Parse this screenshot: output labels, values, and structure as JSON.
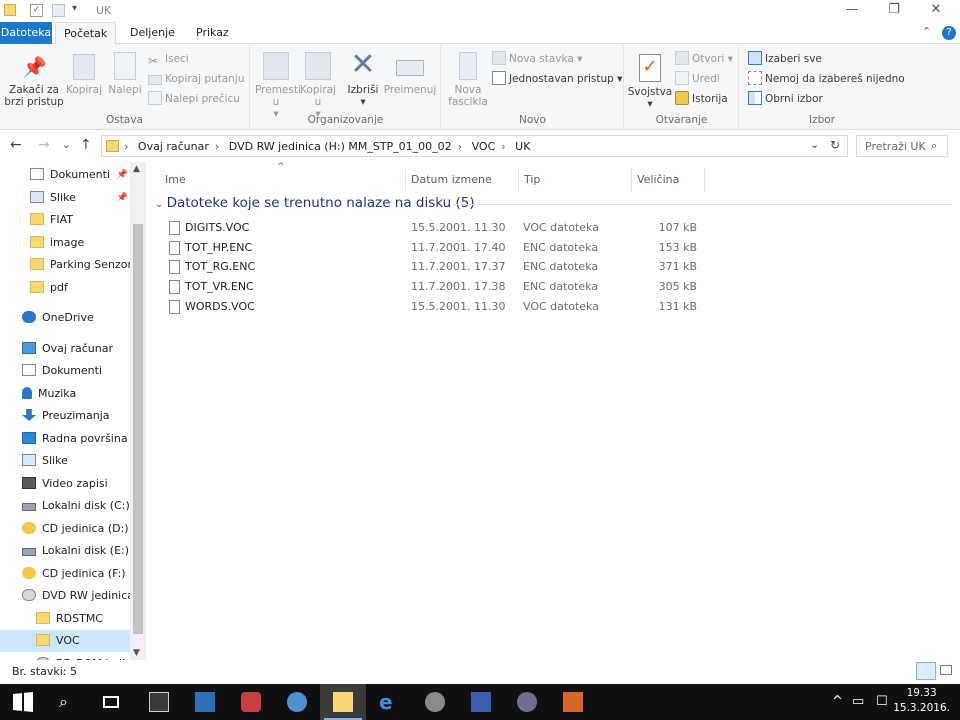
{
  "window": {
    "title": "UK",
    "controls": {
      "minimize": "—",
      "maximize": "❐",
      "close": "✕"
    }
  },
  "tabs": {
    "file": "Datoteka",
    "home": "Početak",
    "share": "Deljenje",
    "view": "Prikaz"
  },
  "ribbon": {
    "clipboard": {
      "label": "Ostava",
      "pin": "Zakači za brzi pristup",
      "copy": "Kopiraj",
      "paste": "Nalepi",
      "cut": "Iseci",
      "copy_path": "Kopiraj putanju",
      "paste_shortcut": "Nalepi prečicu"
    },
    "organize": {
      "label": "Organizovanje",
      "move_to": "Premesti u",
      "copy_to": "Kopiraj u",
      "delete": "Izbriši",
      "rename": "Preimenuj"
    },
    "new": {
      "label": "Novo",
      "new_folder": "Nova fascikla",
      "new_item": "Nova stavka",
      "easy_access": "Jednostavan pristup"
    },
    "open": {
      "label": "Otvaranje",
      "properties": "Svojstva",
      "open": "Otvori",
      "edit": "Uredi",
      "history": "Istorija"
    },
    "select": {
      "label": "Izbor",
      "select_all": "Izaberi sve",
      "select_none": "Nemoj da izabereš nijedno",
      "invert": "Obrni izbor"
    }
  },
  "address": {
    "crumbs": [
      "Ovaj računar",
      "DVD RW jedinica (H:) MM_STP_01_00_02",
      "VOC",
      "UK"
    ],
    "search_placeholder": "Pretraži UK"
  },
  "nav_pane": {
    "items": [
      {
        "label": "Dokumenti",
        "icon": "documents-icon",
        "pinned": true
      },
      {
        "label": "Slike",
        "icon": "pictures-icon",
        "pinned": true
      },
      {
        "label": "FIAT",
        "icon": "folder-icon"
      },
      {
        "label": "image",
        "icon": "folder-icon"
      },
      {
        "label": "Parking Senzori",
        "icon": "folder-icon"
      },
      {
        "label": "pdf",
        "icon": "folder-icon"
      },
      {
        "label": "OneDrive",
        "icon": "onedrive-icon"
      },
      {
        "label": "Ovaj računar",
        "icon": "computer-icon"
      },
      {
        "label": "Dokumenti",
        "icon": "documents-icon"
      },
      {
        "label": "Muzika",
        "icon": "music-icon"
      },
      {
        "label": "Preuzimanja",
        "icon": "downloads-icon"
      },
      {
        "label": "Radna površina",
        "icon": "desktop-icon"
      },
      {
        "label": "Slike",
        "icon": "pictures-icon"
      },
      {
        "label": "Video zapisi",
        "icon": "videos-icon"
      },
      {
        "label": "Lokalni disk (C:)",
        "icon": "drive-icon"
      },
      {
        "label": "CD jedinica (D:)",
        "icon": "cd-icon"
      },
      {
        "label": "Lokalni disk (E:)",
        "icon": "drive-icon"
      },
      {
        "label": "CD jedinica (F:)",
        "icon": "cd-icon"
      },
      {
        "label": "DVD RW jedinica",
        "icon": "dvd-icon"
      },
      {
        "label": "RDSTMC",
        "icon": "folder-icon"
      },
      {
        "label": "VOC",
        "icon": "folder-icon",
        "selected": true
      },
      {
        "label": "BD-ROM jedinic",
        "icon": "dvd-icon"
      }
    ]
  },
  "columns": {
    "name": "Ime",
    "date": "Datum izmene",
    "type": "Tip",
    "size": "Veličina"
  },
  "group_header": "Datoteke koje se trenutno nalaze na disku (5)",
  "files": [
    {
      "name": "DIGITS.VOC",
      "date": "15.5.2001. 11.30",
      "type": "VOC datoteka",
      "size": "107 kB"
    },
    {
      "name": "TOT_HP.ENC",
      "date": "11.7.2001. 17.40",
      "type": "ENC datoteka",
      "size": "153 kB"
    },
    {
      "name": "TOT_RG.ENC",
      "date": "11.7.2001. 17.37",
      "type": "ENC datoteka",
      "size": "371 kB"
    },
    {
      "name": "TOT_VR.ENC",
      "date": "11.7.2001. 17.38",
      "type": "ENC datoteka",
      "size": "305 kB"
    },
    {
      "name": "WORDS.VOC",
      "date": "15.5.2001. 11.30",
      "type": "VOC datoteka",
      "size": "131 kB"
    }
  ],
  "status": "Br. stavki: 5",
  "clock": {
    "time": "19.33",
    "date": "15.3.2016."
  },
  "colors": {
    "accent": "#1979ca",
    "selected": "#cce8ff",
    "group_header": "#1e3287"
  }
}
